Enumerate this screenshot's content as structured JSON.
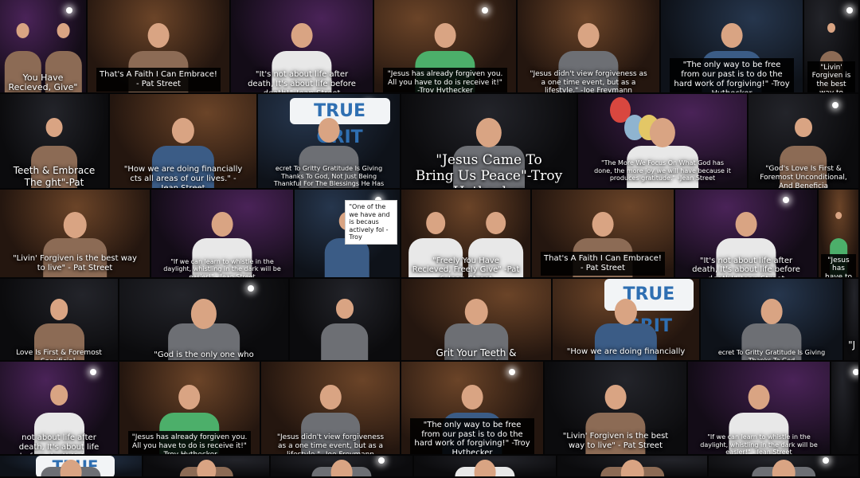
{
  "colors": {
    "warm": "#5a3a22",
    "cool": "#1f2a3a",
    "purple": "#3a1f46",
    "dark": "#15161a",
    "skin": "#d9a483",
    "shirt_green": "#4caf6a",
    "shirt_blue": "#3b5c86",
    "shirt_white": "#e8e8e8",
    "shirt_gray": "#6d6f74",
    "shirt_tan": "#8c6b55"
  },
  "tiles": [
    {
      "caption": "You Have Recieved, Give\" -Pat & Jean Street",
      "style": "shadow",
      "size": 11,
      "capTop": 0.75
    },
    {
      "caption": "That's A Faith I Can Embrace! - Pat Street",
      "style": "box",
      "size": 10,
      "capTop": 0.72
    },
    {
      "caption": "\"It's not about life after death, It's about life before death!\"-Jean Street",
      "style": "shadow",
      "size": 10,
      "capTop": 0.72
    },
    {
      "caption": "\"Jesus has already forgiven you. All you have to do is receive it!\" -Troy Hythecker",
      "style": "box",
      "size": 9,
      "capTop": 0.72
    },
    {
      "caption": "\"Jesus didn't view forgiveness as a one time event, but as a lifestyle.\" -Joe Freymann",
      "style": "shadow",
      "size": 9,
      "capTop": 0.72
    },
    {
      "caption": "\"The only way to be free from our past is to do the hard work of forgiving!\" -Troy Hythecker",
      "style": "box",
      "size": 10,
      "capTop": 0.62
    },
    {
      "caption": "\"Livin' Forgiven is the best way to live\"",
      "style": "box",
      "size": 9,
      "capTop": 0.65
    },
    {
      "caption": "Teeth & Embrace The ght\"-Pat Street",
      "style": "shadow",
      "size": 12,
      "capTop": 0.72
    },
    {
      "caption": "\"How we are doing financially cts all areas of our lives.\" - Jean Street",
      "style": "shadow",
      "size": 10,
      "capTop": 0.72
    },
    {
      "caption": "ecret To Gritty Gratitude Is Giving Thanks To God, Not Just Being Thankful For The Blessings He Has Given Us.\"- Troy Hythecker",
      "style": "shadow",
      "size": 8,
      "capTop": 0.72
    },
    {
      "caption": "\"Jesus Came To Bring Us Peace\"-Troy Hythecker",
      "style": "shadow big",
      "size": 17,
      "capTop": 0.58
    },
    {
      "caption": "\"The More We Focus On What God has done, the more joy we will have because it produces gratitude.\" -Jean Street",
      "style": "shadow",
      "size": 8,
      "capTop": 0.66
    },
    {
      "caption": "\"God's Love Is First & Foremost Unconditional, And Beneficia",
      "style": "shadow",
      "size": 9,
      "capTop": 0.72
    },
    {
      "caption": "\"Livin' Forgiven is the best way to live\" - Pat Street",
      "style": "shadow",
      "size": 10,
      "capTop": 0.7
    },
    {
      "caption": "\"If we can learn to whistle in the daylight, whistling in the dark will be easier!\" - Jean Street",
      "style": "shadow",
      "size": 8,
      "capTop": 0.74
    },
    {
      "caption": "\"One of the we have and is becaus actively fol - Troy",
      "style": "box light",
      "size": 8,
      "capTop": 0.12
    },
    {
      "caption": "\"Freely You Have Recieved, Freely Give\" -Pat & Jean Street",
      "style": "shadow",
      "size": 10,
      "capTop": 0.72
    },
    {
      "caption": "That's A Faith I Can Embrace! - Pat Street",
      "style": "box",
      "size": 10,
      "capTop": 0.7
    },
    {
      "caption": "\"It's not about life after death, It's about life before death!\"-Jean Street",
      "style": "shadow",
      "size": 10,
      "capTop": 0.72
    },
    {
      "caption": "\"Jesus has have to do",
      "style": "box",
      "size": 9,
      "capTop": 0.72
    },
    {
      "caption": "Love Is First & Foremost Sacrificial,",
      "style": "shadow",
      "size": 9,
      "capTop": 0.82
    },
    {
      "caption": "\"God is the only one who",
      "style": "shadow",
      "size": 10,
      "capTop": 0.84
    },
    {
      "caption": "",
      "style": "shadow",
      "size": 10,
      "capTop": 0.8
    },
    {
      "caption": "Grit Your Teeth & Embrace The",
      "style": "shadow",
      "size": 12,
      "capTop": 0.8
    },
    {
      "caption": "\"How we are doing financially",
      "style": "shadow",
      "size": 10,
      "capTop": 0.8
    },
    {
      "caption": "ecret To Gritty Gratitude Is Giving Thanks To God",
      "style": "shadow",
      "size": 8,
      "capTop": 0.82
    },
    {
      "caption": "\"J",
      "style": "shadow",
      "size": 12,
      "capTop": 0.7
    },
    {
      "caption": "not about life after death, It's about life before death!\"-Jean Street",
      "style": "shadow",
      "size": 10,
      "capTop": 0.74
    },
    {
      "caption": "\"Jesus has already forgiven you. All you have to do is receive it!\" -Troy Hythecker",
      "style": "box",
      "size": 9,
      "capTop": 0.74
    },
    {
      "caption": "\"Jesus didn't view forgiveness as a one time event, but as a lifestyle.\" -Joe Freymann",
      "style": "shadow",
      "size": 9,
      "capTop": 0.74
    },
    {
      "caption": "\"The only way to be free from our past is to do the hard work of forgiving!\" -Troy Hythecker",
      "style": "box",
      "size": 10,
      "capTop": 0.6
    },
    {
      "caption": "\"Livin' Forgiven is the best way to live\" - Pat Street",
      "style": "shadow",
      "size": 10,
      "capTop": 0.72
    },
    {
      "caption": "\"If we can learn to whistle in the daylight, whistling in the dark will be easier!\" - Jean Street",
      "style": "shadow",
      "size": 8,
      "capTop": 0.74
    },
    {
      "caption": "",
      "style": "shadow",
      "size": 9,
      "capTop": 0.8
    },
    {
      "caption": "",
      "style": "shadow",
      "size": 10,
      "capTop": 0.8
    },
    {
      "caption": "",
      "style": "shadow",
      "size": 10,
      "capTop": 0.8
    },
    {
      "caption": "",
      "style": "shadow",
      "size": 10,
      "capTop": 0.8
    },
    {
      "caption": "",
      "style": "shadow",
      "size": 10,
      "capTop": 0.8
    },
    {
      "caption": "",
      "style": "shadow",
      "size": 10,
      "capTop": 0.8
    },
    {
      "caption": "",
      "style": "shadow",
      "size": 10,
      "capTop": 0.8
    }
  ],
  "banners": [
    "TRUE GRIT",
    "TRUE GRIT",
    "TRUE GRIT",
    "TRUE GRIT"
  ]
}
